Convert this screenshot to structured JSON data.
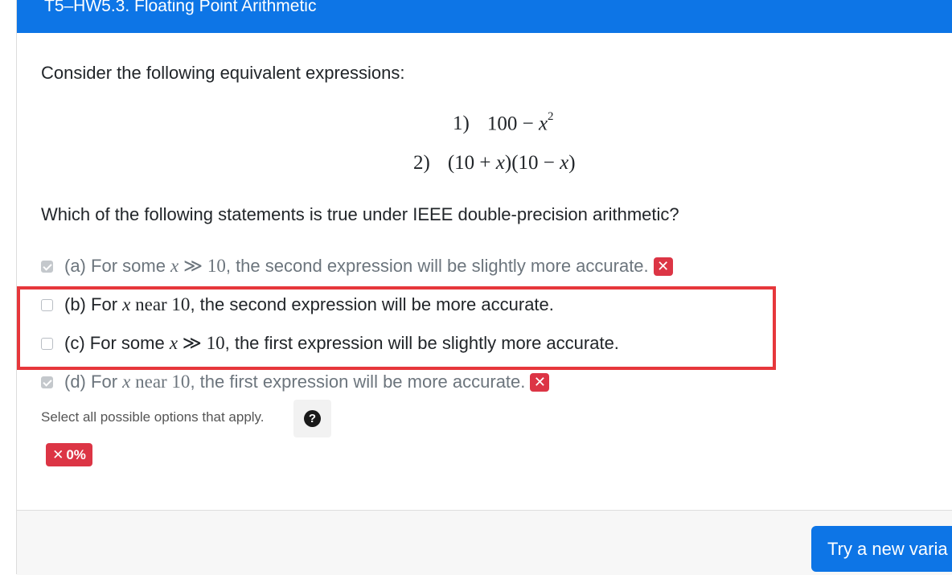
{
  "header": {
    "title": "T5–HW5.3. Floating Point Arithmetic"
  },
  "question": {
    "prompt": "Consider the following equivalent expressions:",
    "expressions": [
      {
        "num": "1)",
        "before": "100 − ",
        "var": "x",
        "sup": "2",
        "after": ""
      },
      {
        "num": "2)",
        "before": "(10 + ",
        "var": "x",
        "mid": ")(10 − ",
        "var2": "x",
        "after": ")"
      }
    ],
    "stem": "Which of the following statements is true under IEEE double-precision arithmetic?"
  },
  "options": [
    {
      "letter": "(a)",
      "pre": "For some ",
      "var": "x",
      "rel": " ≫ 10",
      "post": ", the second expression will be slightly more accurate.",
      "checked": true,
      "result": "✕"
    },
    {
      "letter": "(b)",
      "pre": "For ",
      "var": "x",
      "rel": " near 10",
      "post": ", the second expression will be more accurate.",
      "checked": false
    },
    {
      "letter": "(c)",
      "pre": "For some ",
      "var": "x",
      "rel": " ≫ 10",
      "post": ", the first expression will be slightly more accurate.",
      "checked": false
    },
    {
      "letter": "(d)",
      "pre": "For ",
      "var": "x",
      "rel": " near 10",
      "post": ", the first expression will be more accurate.",
      "checked": true,
      "result": "✕"
    }
  ],
  "helper": {
    "text": "Select all possible options that apply.",
    "help_icon": "?"
  },
  "score": {
    "icon": "✕",
    "value": "0%"
  },
  "footer": {
    "new_variant_label": "Try a new varia"
  },
  "colors": {
    "primary": "#0d75e6",
    "danger": "#dc3545",
    "highlight": "#e6373b"
  }
}
